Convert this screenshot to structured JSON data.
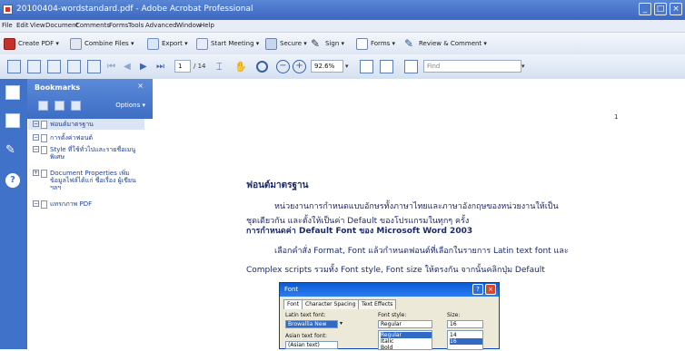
{
  "window": {
    "title": "20100404-wordstandard.pdf - Adobe Acrobat Professional"
  },
  "menu": [
    "File",
    "Edit",
    "View",
    "Document",
    "Comments",
    "Forms",
    "Tools",
    "Advanced",
    "Window",
    "Help"
  ],
  "task_toolbar": {
    "create_pdf": "Create PDF",
    "combine_files": "Combine Files",
    "export": "Export",
    "start_meeting": "Start Meeting",
    "secure": "Secure",
    "sign": "Sign",
    "forms": "Forms",
    "review_comment": "Review & Comment"
  },
  "nav_toolbar": {
    "page_current": "1",
    "page_total": "/ 14",
    "zoom": "92.6%",
    "find": "Find"
  },
  "bookmarks": {
    "title": "Bookmarks",
    "options": "Options",
    "items": [
      {
        "label": "ฟอนต์มาตรฐาน"
      },
      {
        "label": "การตั้งค่าฟอนต์"
      },
      {
        "label": "Style ที่ใช้ทั่วไปและรายชื่อเมนูพิเศษ"
      },
      {
        "label": "Document Properties เพิ่มข้อมูลไฟล์ได้แก่ ชื่อเรื่อง ผู้เขียน ฯลฯ"
      },
      {
        "label": "แทรกภาพ PDF"
      }
    ]
  },
  "document": {
    "page_number": "1",
    "heading1": "ฟอนต์มาตรฐาน",
    "para1_line1": "หน่วยงานการกำหนดแบบอักษรทั้งภาษาไทยและภาษาอังกฤษของหน่วยงานให้เป็น",
    "para1_line2": "ชุดเดียวกัน และตั้งให้เป็นค่า Default ของโปรแกรมในทุกๆ ครั้ง",
    "heading2": "การกำหนดค่า Default Font ของ Microsoft Word 2003",
    "para2_line1": "เลือกคำสั่ง Format, Font แล้วกำหนดฟอนต์ที่เลือกในรายการ Latin text font และ",
    "para2_line2": "Complex scripts รวมทั้ง Font style, Font size ให้ตรงกัน จากนั้นคลิกปุ่ม Default"
  },
  "font_dialog": {
    "title": "Font",
    "tabs": [
      "Font",
      "Character Spacing",
      "Text Effects"
    ],
    "latin_label": "Latin text font:",
    "latin_value": "Browallia New",
    "style_label": "Font style:",
    "style_value": "Regular",
    "style_options": [
      "Regular",
      "Italic",
      "Bold"
    ],
    "size_label": "Size:",
    "size_value": "16",
    "size_options": [
      "14",
      "16"
    ],
    "asian_label": "Asian text font:",
    "asian_value": "(Asian text)"
  }
}
